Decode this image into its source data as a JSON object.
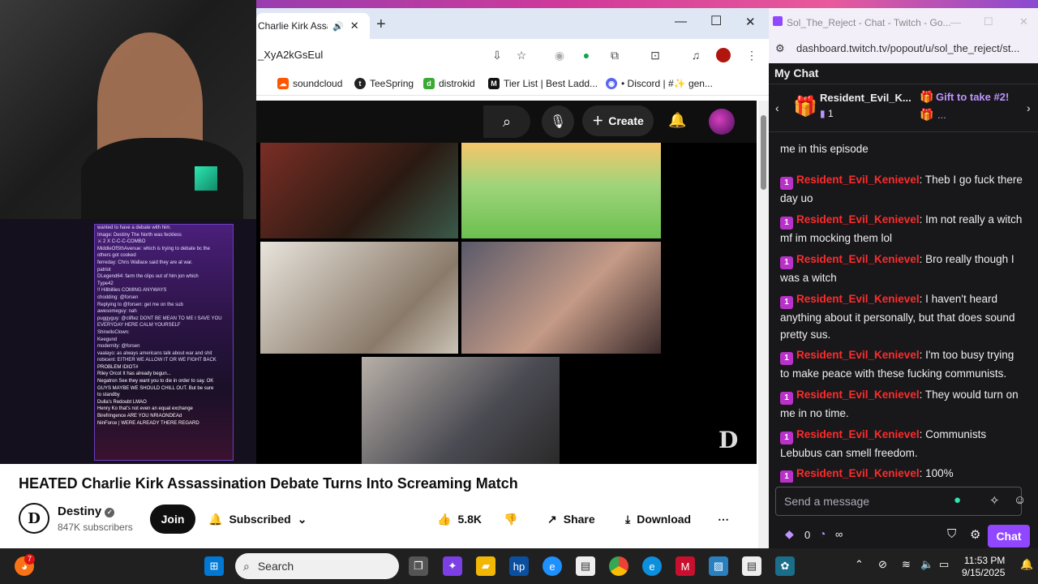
{
  "browser": {
    "tab_title": "Charlie Kirk Assass",
    "url": "_XyA2kGsEul",
    "bookmarks": [
      {
        "label": "soundcloud",
        "color": "#ff5500"
      },
      {
        "label": "TeeSpring",
        "color": "#222222"
      },
      {
        "label": "distrokid",
        "color": "#3aaa35"
      },
      {
        "label": "Tier List | Best Ladd...",
        "color": "#111111"
      },
      {
        "label": "• Discord | #✨ gen...",
        "color": "#5865f2"
      }
    ]
  },
  "youtube": {
    "create_label": "Create",
    "video_title": "HEATED Charlie Kirk Assassination Debate Turns Into Screaming Match",
    "channel_name": "Destiny",
    "subscribers": "847K subscribers",
    "join_label": "Join",
    "subscribed_label": "Subscribed",
    "likes": "5.8K",
    "share_label": "Share",
    "download_label": "Download"
  },
  "overlay_chat": [
    "wanted to have a debate with him.",
    "Image: Destiny The North was feckless",
    "⚔ 2 X C-C-C-COMBO",
    "MiddleOfSthAvenue: which is trying to debate bc the",
    "others got cooked",
    "ferreday: Chris Wallace said they are at war.",
    "patriot",
    "DLegend64: farm the clips out of him jon which",
    "Type42",
    "!! Hillbillies COMING ANYWAYS",
    "chodding: @forsen",
    "Replying to @forsen: get me on the sub",
    "awesomeguy: nah",
    "puggyguy: @cliftez DONT BE MEAN TO ME I SAVE YOU",
    "EVERYDAY HERE CALM YOURSELF",
    "ShinelloClown:",
    "Keegund",
    "modernity: @forsen",
    "vaalayo: as always americans talk about war and shit",
    "robicent: EITHER WE ALLOW IT OR WE FIGHT BACK",
    "",
    "PROBLEM IDIOT#",
    "Riley Orcot It has already begun...",
    "Negatron See they want you to die in order to say. OK",
    "GUYS MAYBE WE SHOULD CHILL OUT. But be sure",
    "to standby",
    "Dulla's Redoubt LMAO",
    "Henry Ko that's not even an equal exchange",
    "Birefringence ARE YOU NRIAONDEAd",
    "NinForce | WERE ALREADY THERE REGARD"
  ],
  "twitch": {
    "window_title": "Sol_The_Reject - Chat - Twitch - Go...",
    "url": "dashboard.twitch.tv/popout/u/sol_the_reject/st...",
    "header": "My Chat",
    "gift_user": "Resident_Evil_K...",
    "gift_count": "1",
    "gift_text": "Gift to take #2!",
    "gift_more": "...",
    "partial_line": "me in this episode",
    "username": "Resident_Evil_Kenievel",
    "messages": [
      "Theb I go fuck there day uo",
      "Im not really a witch mf im mocking them lol",
      "Bro really though I was a witch",
      "I haven't heard anything about it personally, but that does sound pretty sus.",
      "I'm too busy trying to make peace with these fucking communists.",
      "They would turn on me in no time.",
      "Communists Lebubus can smell freedom.",
      "100%"
    ],
    "input_placeholder": "Send a message",
    "points": "0",
    "infinity": "∞",
    "chat_button": "Chat"
  },
  "taskbar": {
    "search_placeholder": "Search",
    "badge_count": "7",
    "time": "11:53 PM",
    "date": "9/15/2025"
  }
}
